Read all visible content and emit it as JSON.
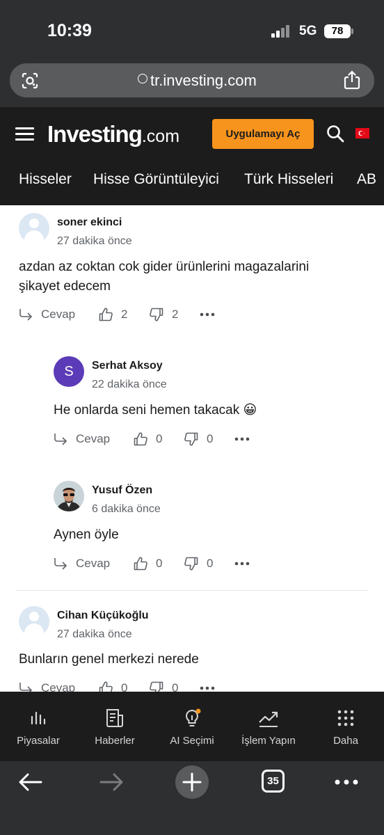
{
  "status_bar": {
    "time": "10:39",
    "network": "5G",
    "battery": "78"
  },
  "browser": {
    "url": "tr.investing.com",
    "tab_count": "35"
  },
  "site": {
    "logo_main": "Investing",
    "logo_suffix": ".com",
    "open_app_label": "Uygulamayı Aç",
    "nav_tabs": [
      "Hisseler",
      "Hisse Görüntüleyici",
      "Türk Hisseleri",
      "AB"
    ]
  },
  "comments": [
    {
      "author": "soner ekinci",
      "time": "27 dakika önce",
      "text_lines": [
        "azdan az coktan cok gider ürünlerini magazalarini",
        "şikayet edecem"
      ],
      "reply_label": "Cevap",
      "likes": "2",
      "dislikes": "2"
    },
    {
      "author": "Serhat Aksoy",
      "avatar_letter": "S",
      "time": "22 dakika önce",
      "text": "He onlarda seni hemen takacak 😀",
      "reply_label": "Cevap",
      "likes": "0",
      "dislikes": "0"
    },
    {
      "author": "Yusuf Özen",
      "time": "6 dakika önce",
      "text": "Aynen öyle",
      "reply_label": "Cevap",
      "likes": "0",
      "dislikes": "0"
    },
    {
      "author": "Cihan Küçükoğlu",
      "time": "27 dakika önce",
      "text": "Bunların genel merkezi nerede",
      "reply_label": "Cevap",
      "likes": "0",
      "dislikes": "0"
    }
  ],
  "bottom_nav": [
    "Piyasalar",
    "Haberler",
    "AI Seçimi",
    "İşlem Yapın",
    "Daha"
  ],
  "colors": {
    "accent": "#f7941d",
    "header_bg": "#1c1c1c",
    "chrome_bg": "#2d2f31",
    "avatar_purple": "#5b3bb7"
  }
}
